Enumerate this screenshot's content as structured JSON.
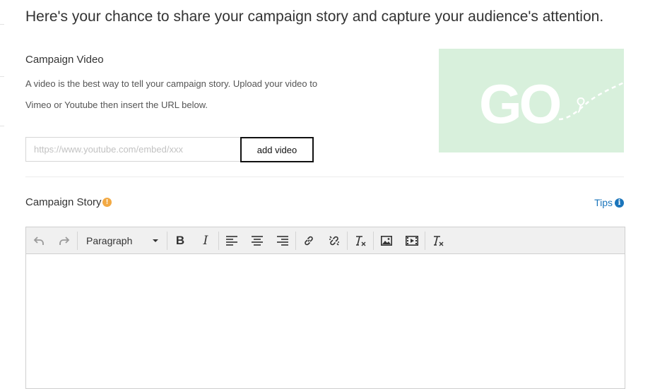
{
  "header": {
    "title": "Here's your chance to share your campaign story and capture your audience's attention."
  },
  "video_section": {
    "label": "Campaign Video",
    "description_line1": "A video is the best way to tell your campaign story. Upload your video to",
    "description_line2": "Vimeo or Youtube then insert the URL below.",
    "url_placeholder": "https://www.youtube.com/embed/xxx",
    "url_value": "",
    "add_button_label": "add video",
    "image_text": "GO",
    "image_bg_color": "#d8f0dc"
  },
  "story_section": {
    "label": "Campaign Story",
    "warning_glyph": "!",
    "tips_label": "Tips",
    "info_glyph": "i",
    "tips_color": "#1b75bb",
    "warning_color": "#f2a944"
  },
  "editor": {
    "format_select_value": "Paragraph",
    "bold_glyph": "B",
    "italic_glyph": "I",
    "toolbar_icons": [
      "undo-icon",
      "redo-icon",
      "bold-icon",
      "italic-icon",
      "align-left-icon",
      "align-center-icon",
      "align-right-icon",
      "link-icon",
      "unlink-icon",
      "clear-formatting-icon",
      "image-icon",
      "video-icon",
      "clear-formatting-icon"
    ],
    "content": ""
  }
}
